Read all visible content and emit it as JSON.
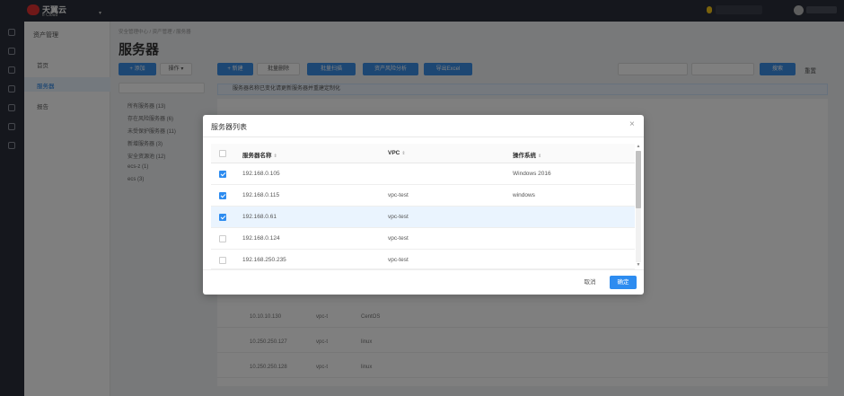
{
  "app": {
    "logo_text": "天翼云",
    "logo_sub": "e Cloud"
  },
  "background": {
    "nav_title": "资产管理",
    "nav_items": [
      "首页",
      "服务器",
      "报告"
    ],
    "breadcrumb": "安全管理中心 / 资产管理 / 服务器",
    "page_title": "服务器",
    "add_label": "+ 添加",
    "action_label": "操作 ▾",
    "tree_items": [
      "所有服务器 (13)",
      "存在风险服务器 (6)",
      "未受保护服务器 (11)",
      "新增服务器 (3)",
      "安全资源池 (12)",
      "ecs-z (1)",
      "ecs (3)"
    ],
    "toolbar_buttons": [
      "+ 新建",
      "批量删除",
      "批量扫描",
      "资产风险分析",
      "导出Excel"
    ],
    "search_label": "搜索",
    "reset_label": "重置",
    "info_text": "服务器名称已变化请更新服务器并重建定制化",
    "table_rows": [
      {
        "ip": "10.10.10.130",
        "vpc": "vpc-t",
        "os": "CentOS"
      },
      {
        "ip": "10.250.250.127",
        "vpc": "vpc-t",
        "os": "linux"
      },
      {
        "ip": "10.250.250.128",
        "vpc": "vpc-t",
        "os": "linux"
      }
    ]
  },
  "dialog": {
    "title": "服务器列表",
    "close_icon": "close-icon",
    "columns": [
      "服务器名称",
      "VPC",
      "操作系统"
    ],
    "sort_glyph": "⇕",
    "rows": [
      {
        "name": "192.168.0.105",
        "vpc": "",
        "os": "Windows 2016",
        "checked": true,
        "highlight": false
      },
      {
        "name": "192.168.0.115",
        "vpc": "vpc-test",
        "os": "windows",
        "checked": true,
        "highlight": false
      },
      {
        "name": "192.168.0.61",
        "vpc": "vpc-test",
        "os": "",
        "checked": true,
        "highlight": true
      },
      {
        "name": "192.168.0.124",
        "vpc": "vpc-test",
        "os": "",
        "checked": false,
        "highlight": false
      },
      {
        "name": "192.168.250.235",
        "vpc": "vpc-test",
        "os": "",
        "checked": false,
        "highlight": false
      }
    ],
    "cancel_label": "取消",
    "ok_label": "确定"
  },
  "colors": {
    "primary": "#2d8cf0",
    "topbar": "#2b2f3a",
    "overlay": "rgba(0,0,0,0.5)"
  }
}
